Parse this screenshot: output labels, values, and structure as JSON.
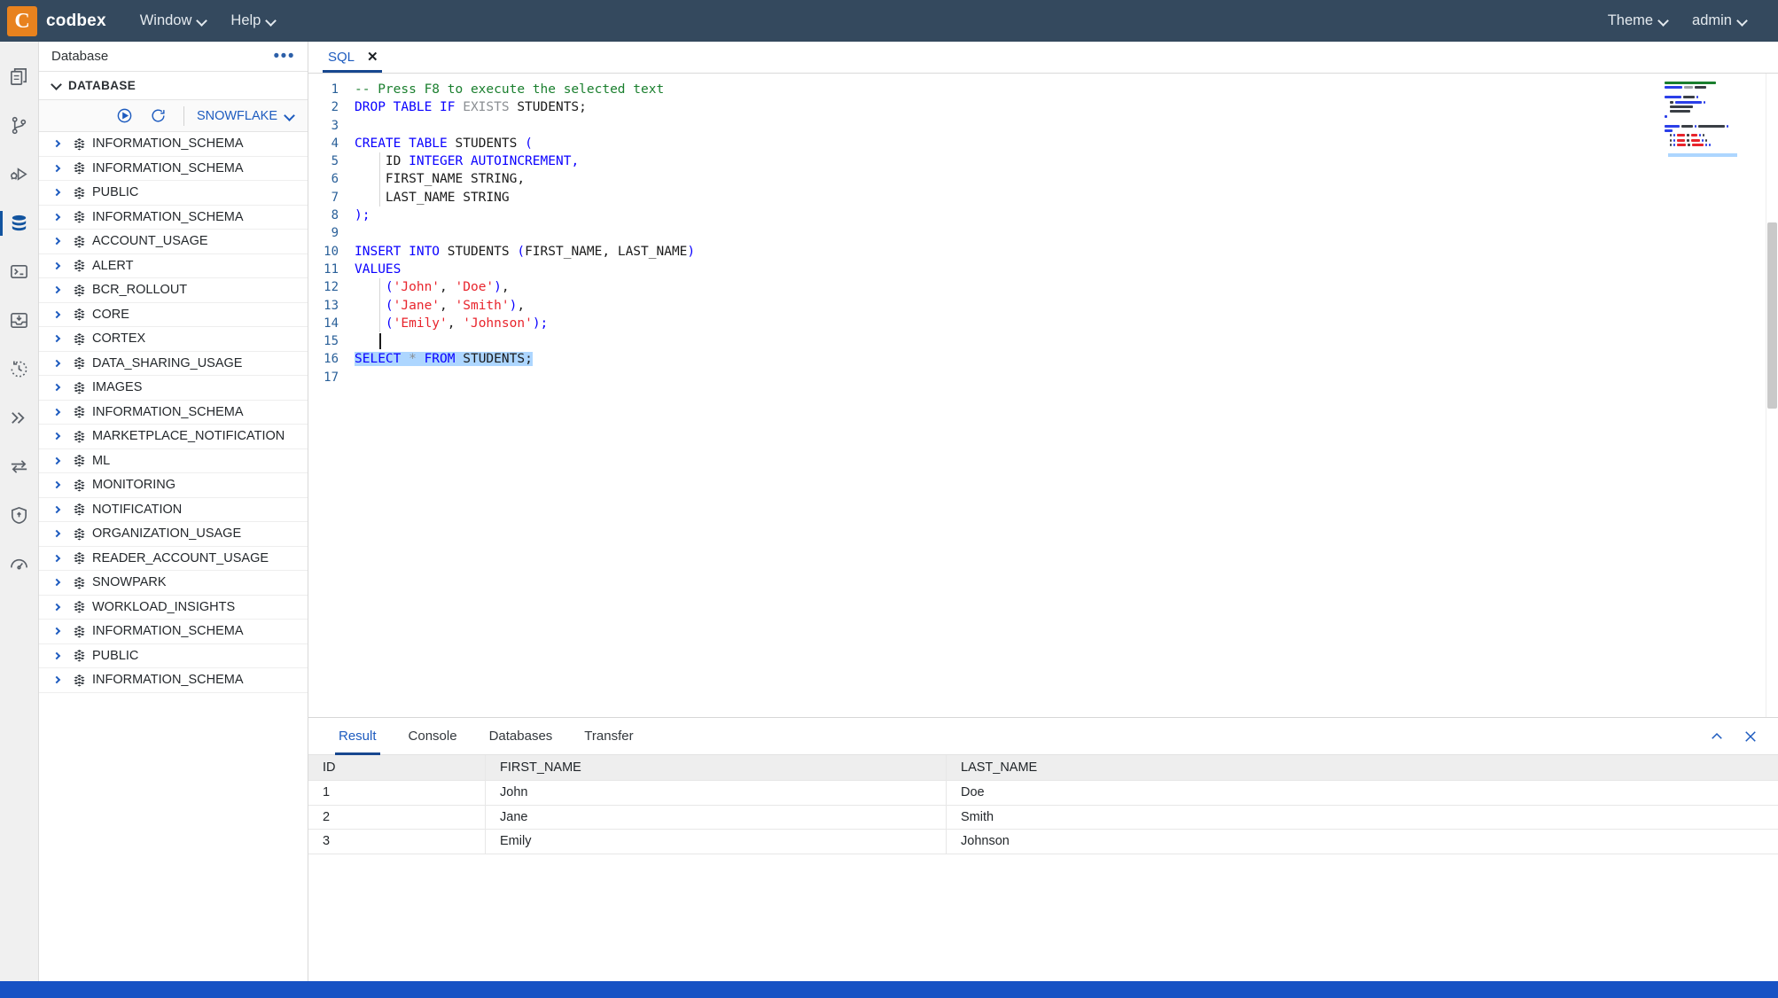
{
  "topbar": {
    "logo_letter": "C",
    "brand": "codbex",
    "menus": [
      {
        "label": "Window",
        "icon": "chevron-down-icon"
      },
      {
        "label": "Help",
        "icon": "chevron-down-icon"
      }
    ],
    "theme_label": "Theme",
    "user_label": "admin"
  },
  "activitybar": {
    "items": [
      {
        "name": "files-icon",
        "active": false
      },
      {
        "name": "git-branch-icon",
        "active": false
      },
      {
        "name": "debug-run-icon",
        "active": false
      },
      {
        "name": "database-icon",
        "active": true
      },
      {
        "name": "terminal-icon",
        "active": false
      },
      {
        "name": "inbox-icon",
        "active": false
      },
      {
        "name": "history-icon",
        "active": false
      },
      {
        "name": "chevrons-right-icon",
        "active": false
      },
      {
        "name": "transfer-icon",
        "active": false
      },
      {
        "name": "shield-icon",
        "active": false
      },
      {
        "name": "gauge-icon",
        "active": false
      }
    ]
  },
  "explorer": {
    "title": "Database",
    "more_label": "•••",
    "section_title": "DATABASE",
    "toolbar": {
      "run_icon": "play-circle-icon",
      "refresh_icon": "refresh-icon",
      "datasource_label": "SNOWFLAKE"
    },
    "tree_items": [
      "INFORMATION_SCHEMA",
      "INFORMATION_SCHEMA",
      "PUBLIC",
      "INFORMATION_SCHEMA",
      "ACCOUNT_USAGE",
      "ALERT",
      "BCR_ROLLOUT",
      "CORE",
      "CORTEX",
      "DATA_SHARING_USAGE",
      "IMAGES",
      "INFORMATION_SCHEMA",
      "MARKETPLACE_NOTIFICATION",
      "ML",
      "MONITORING",
      "NOTIFICATION",
      "ORGANIZATION_USAGE",
      "READER_ACCOUNT_USAGE",
      "SNOWPARK",
      "WORKLOAD_INSIGHTS",
      "INFORMATION_SCHEMA",
      "PUBLIC",
      "INFORMATION_SCHEMA"
    ]
  },
  "editor": {
    "tab_label": "SQL",
    "tab_close": "✕",
    "lines": [
      {
        "n": "1",
        "tokens": [
          {
            "t": "-- Press F8 to execute the selected text",
            "c": "cm"
          }
        ]
      },
      {
        "n": "2",
        "tokens": [
          {
            "t": "DROP TABLE IF ",
            "c": "kw"
          },
          {
            "t": "EXISTS ",
            "c": "gy"
          },
          {
            "t": "STUDENTS;",
            "c": ""
          }
        ]
      },
      {
        "n": "3",
        "tokens": []
      },
      {
        "n": "4",
        "tokens": [
          {
            "t": "CREATE TABLE ",
            "c": "kw"
          },
          {
            "t": "STUDENTS ",
            "c": ""
          },
          {
            "t": "(",
            "c": "pn"
          }
        ]
      },
      {
        "n": "5",
        "tokens": [
          {
            "t": "    ID ",
            "c": ""
          },
          {
            "t": "INTEGER AUTOINCREMENT",
            "c": "kw"
          },
          {
            "t": ",",
            "c": "pn"
          }
        ],
        "guide": true
      },
      {
        "n": "6",
        "tokens": [
          {
            "t": "    FIRST_NAME STRING,",
            "c": ""
          }
        ],
        "guide": true
      },
      {
        "n": "7",
        "tokens": [
          {
            "t": "    LAST_NAME STRING",
            "c": ""
          }
        ],
        "guide": true
      },
      {
        "n": "8",
        "tokens": [
          {
            "t": ");",
            "c": "pn"
          }
        ]
      },
      {
        "n": "9",
        "tokens": []
      },
      {
        "n": "10",
        "tokens": [
          {
            "t": "INSERT INTO ",
            "c": "kw"
          },
          {
            "t": "STUDENTS ",
            "c": ""
          },
          {
            "t": "(",
            "c": "pn"
          },
          {
            "t": "FIRST_NAME, LAST_NAME",
            "c": ""
          },
          {
            "t": ")",
            "c": "pn"
          }
        ]
      },
      {
        "n": "11",
        "tokens": [
          {
            "t": "VALUES",
            "c": "kw"
          }
        ]
      },
      {
        "n": "12",
        "tokens": [
          {
            "t": "    ",
            "c": ""
          },
          {
            "t": "(",
            "c": "pn"
          },
          {
            "t": "'John'",
            "c": "st"
          },
          {
            "t": ", ",
            "c": ""
          },
          {
            "t": "'Doe'",
            "c": "st"
          },
          {
            "t": ")",
            "c": "pn"
          },
          {
            "t": ",",
            "c": ""
          }
        ],
        "guide": true
      },
      {
        "n": "13",
        "tokens": [
          {
            "t": "    ",
            "c": ""
          },
          {
            "t": "(",
            "c": "pn"
          },
          {
            "t": "'Jane'",
            "c": "st"
          },
          {
            "t": ", ",
            "c": ""
          },
          {
            "t": "'Smith'",
            "c": "st"
          },
          {
            "t": ")",
            "c": "pn"
          },
          {
            "t": ",",
            "c": ""
          }
        ],
        "guide": true
      },
      {
        "n": "14",
        "tokens": [
          {
            "t": "    ",
            "c": ""
          },
          {
            "t": "(",
            "c": "pn"
          },
          {
            "t": "'Emily'",
            "c": "st"
          },
          {
            "t": ", ",
            "c": ""
          },
          {
            "t": "'Johnson'",
            "c": "st"
          },
          {
            "t": ")",
            "c": "pn"
          },
          {
            "t": ";",
            "c": "pn"
          }
        ],
        "guide": true
      },
      {
        "n": "15",
        "tokens": [],
        "caret": true
      },
      {
        "n": "16",
        "tokens": [
          {
            "t": "SELECT ",
            "c": "kw sel"
          },
          {
            "t": "* ",
            "c": "gy sel"
          },
          {
            "t": "FROM ",
            "c": "kw sel"
          },
          {
            "t": "STUDENTS;",
            "c": "sel"
          }
        ]
      },
      {
        "n": "17",
        "tokens": []
      }
    ]
  },
  "results": {
    "tabs": [
      {
        "label": "Result",
        "active": true
      },
      {
        "label": "Console",
        "active": false
      },
      {
        "label": "Databases",
        "active": false
      },
      {
        "label": "Transfer",
        "active": false
      }
    ],
    "actions": [
      {
        "name": "collapse-panel-icon"
      },
      {
        "name": "close-panel-icon"
      }
    ],
    "columns": [
      "ID",
      "FIRST_NAME",
      "LAST_NAME"
    ],
    "rows": [
      [
        "1",
        "John",
        "Doe"
      ],
      [
        "2",
        "Jane",
        "Smith"
      ],
      [
        "3",
        "Emily",
        "Johnson"
      ]
    ]
  },
  "colors": {
    "topbar_bg": "#34495e",
    "accent": "#1d5bbf",
    "logo_bg": "#e8821e",
    "statusbar_bg": "#1752c4",
    "selection": "#add6ff"
  }
}
